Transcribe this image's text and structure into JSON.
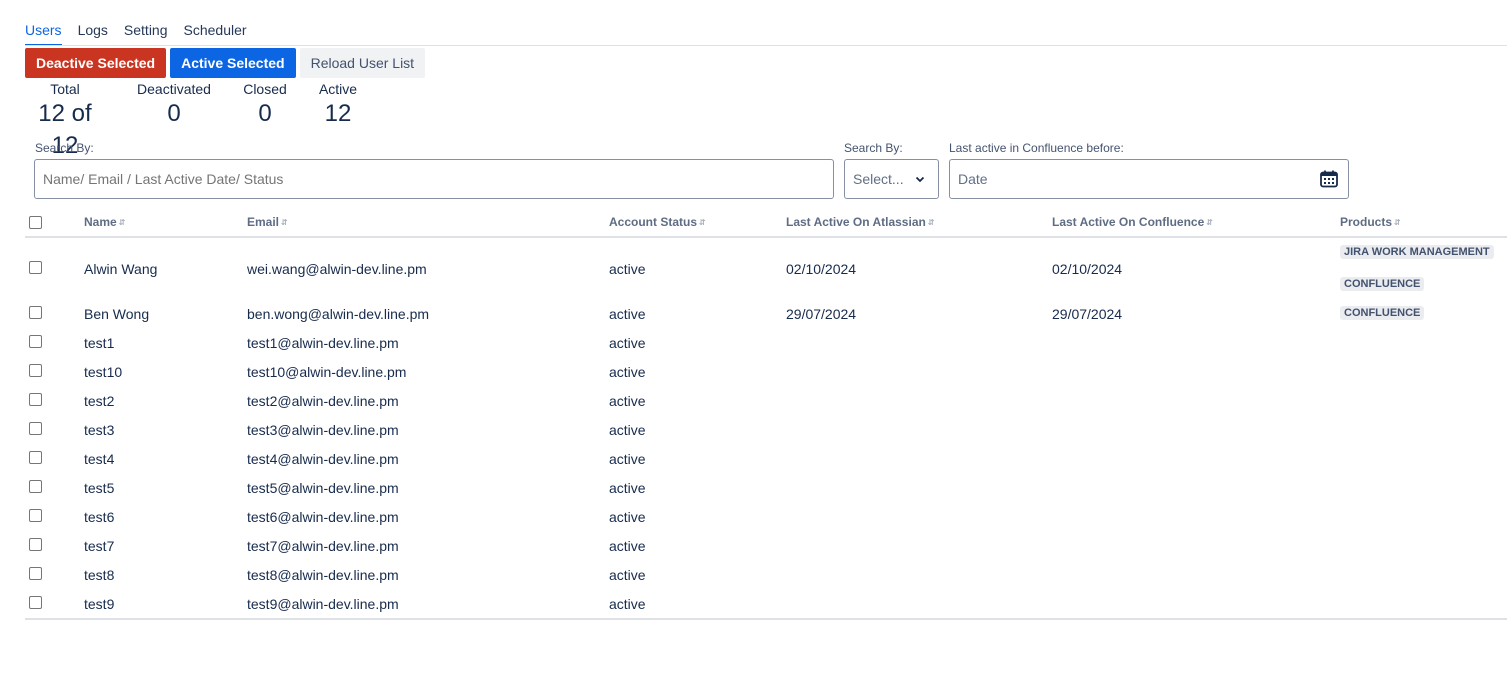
{
  "tabs": [
    {
      "label": "Users"
    },
    {
      "label": "Logs"
    },
    {
      "label": "Setting"
    },
    {
      "label": "Scheduler"
    }
  ],
  "toolbar": {
    "deactive_label": "Deactive Selected",
    "active_label": "Active Selected",
    "reload_label": "Reload User List"
  },
  "stats": {
    "total_label": "Total",
    "total_value": "12 of 12",
    "deactivated_label": "Deactivated",
    "deactivated_value": "0",
    "closed_label": "Closed",
    "closed_value": "0",
    "active_label": "Active",
    "active_value": "12"
  },
  "search": {
    "label": "Search By:",
    "placeholder": "Name/ Email / Last Active Date/ Status",
    "by_label": "Search By:",
    "by_value": "Select...",
    "date_label": "Last active in Confluence before:",
    "date_placeholder": "Date"
  },
  "table": {
    "headers": {
      "name": "Name",
      "email": "Email",
      "status": "Account Status",
      "atlassian": "Last Active On Atlassian",
      "confluence": "Last Active On Confluence",
      "products": "Products"
    },
    "rows": [
      {
        "name": "Alwin Wang",
        "email": "wei.wang@alwin-dev.line.pm",
        "status": "active",
        "atlassian": "02/10/2024",
        "confluence": "02/10/2024",
        "products": [
          "JIRA WORK MANAGEMENT",
          "CONFLUENCE"
        ]
      },
      {
        "name": "Ben Wong",
        "email": "ben.wong@alwin-dev.line.pm",
        "status": "active",
        "atlassian": "29/07/2024",
        "confluence": "29/07/2024",
        "products": [
          "CONFLUENCE"
        ]
      },
      {
        "name": "test1",
        "email": "test1@alwin-dev.line.pm",
        "status": "active",
        "atlassian": "",
        "confluence": "",
        "products": []
      },
      {
        "name": "test10",
        "email": "test10@alwin-dev.line.pm",
        "status": "active",
        "atlassian": "",
        "confluence": "",
        "products": []
      },
      {
        "name": "test2",
        "email": "test2@alwin-dev.line.pm",
        "status": "active",
        "atlassian": "",
        "confluence": "",
        "products": []
      },
      {
        "name": "test3",
        "email": "test3@alwin-dev.line.pm",
        "status": "active",
        "atlassian": "",
        "confluence": "",
        "products": []
      },
      {
        "name": "test4",
        "email": "test4@alwin-dev.line.pm",
        "status": "active",
        "atlassian": "",
        "confluence": "",
        "products": []
      },
      {
        "name": "test5",
        "email": "test5@alwin-dev.line.pm",
        "status": "active",
        "atlassian": "",
        "confluence": "",
        "products": []
      },
      {
        "name": "test6",
        "email": "test6@alwin-dev.line.pm",
        "status": "active",
        "atlassian": "",
        "confluence": "",
        "products": []
      },
      {
        "name": "test7",
        "email": "test7@alwin-dev.line.pm",
        "status": "active",
        "atlassian": "",
        "confluence": "",
        "products": []
      },
      {
        "name": "test8",
        "email": "test8@alwin-dev.line.pm",
        "status": "active",
        "atlassian": "",
        "confluence": "",
        "products": []
      },
      {
        "name": "test9",
        "email": "test9@alwin-dev.line.pm",
        "status": "active",
        "atlassian": "",
        "confluence": "",
        "products": []
      }
    ]
  },
  "colors": {
    "danger": "#ca3521",
    "primary": "#0c66e4",
    "neutral": "#f1f2f4"
  }
}
